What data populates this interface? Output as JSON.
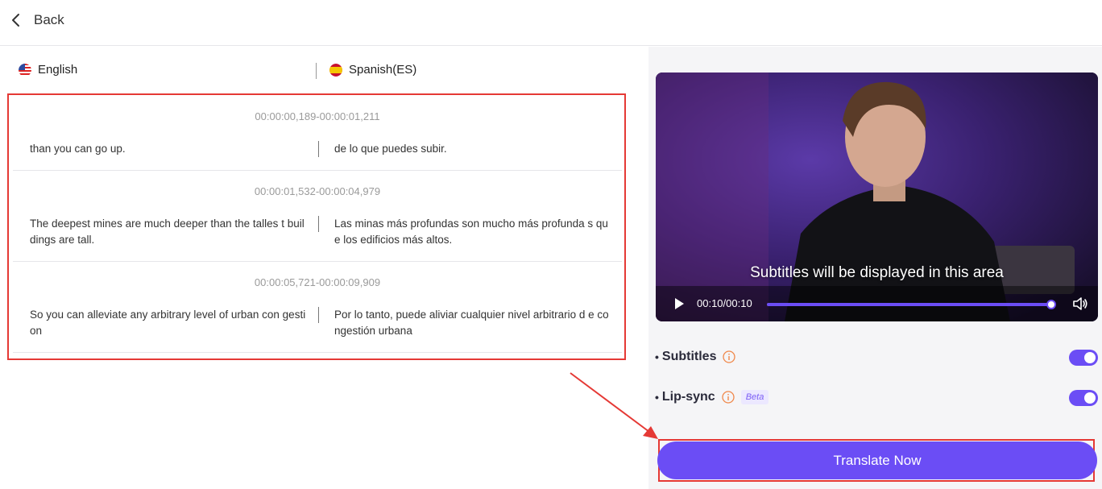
{
  "header": {
    "back_label": "Back"
  },
  "languages": {
    "source": "English",
    "target": "Spanish(ES)"
  },
  "segments": [
    {
      "time": "00:00:00,189-00:00:01,211",
      "source": "than you can go up.",
      "target": "de lo que puedes subir."
    },
    {
      "time": "00:00:01,532-00:00:04,979",
      "source": "The deepest mines are much deeper than the talles t buildings are tall.",
      "target": "Las minas más profundas son mucho más profunda s que los edificios más altos."
    },
    {
      "time": "00:00:05,721-00:00:09,909",
      "source": "So you can alleviate any arbitrary level of urban con gestion",
      "target": "Por lo tanto, puede aliviar cualquier nivel arbitrario d e congestión urbana"
    }
  ],
  "video": {
    "subtitle_placeholder": "Subtitles will be displayed in this area",
    "time": "00:10/00:10",
    "progress": 1.0
  },
  "options": {
    "subtitles": {
      "label": "Subtitles",
      "enabled": true
    },
    "lipsync": {
      "label": "Lip-sync",
      "badge": "Beta",
      "enabled": true
    }
  },
  "cta": {
    "label": "Translate Now"
  },
  "colors": {
    "accent": "#6b4df5",
    "highlight": "#e53935"
  }
}
